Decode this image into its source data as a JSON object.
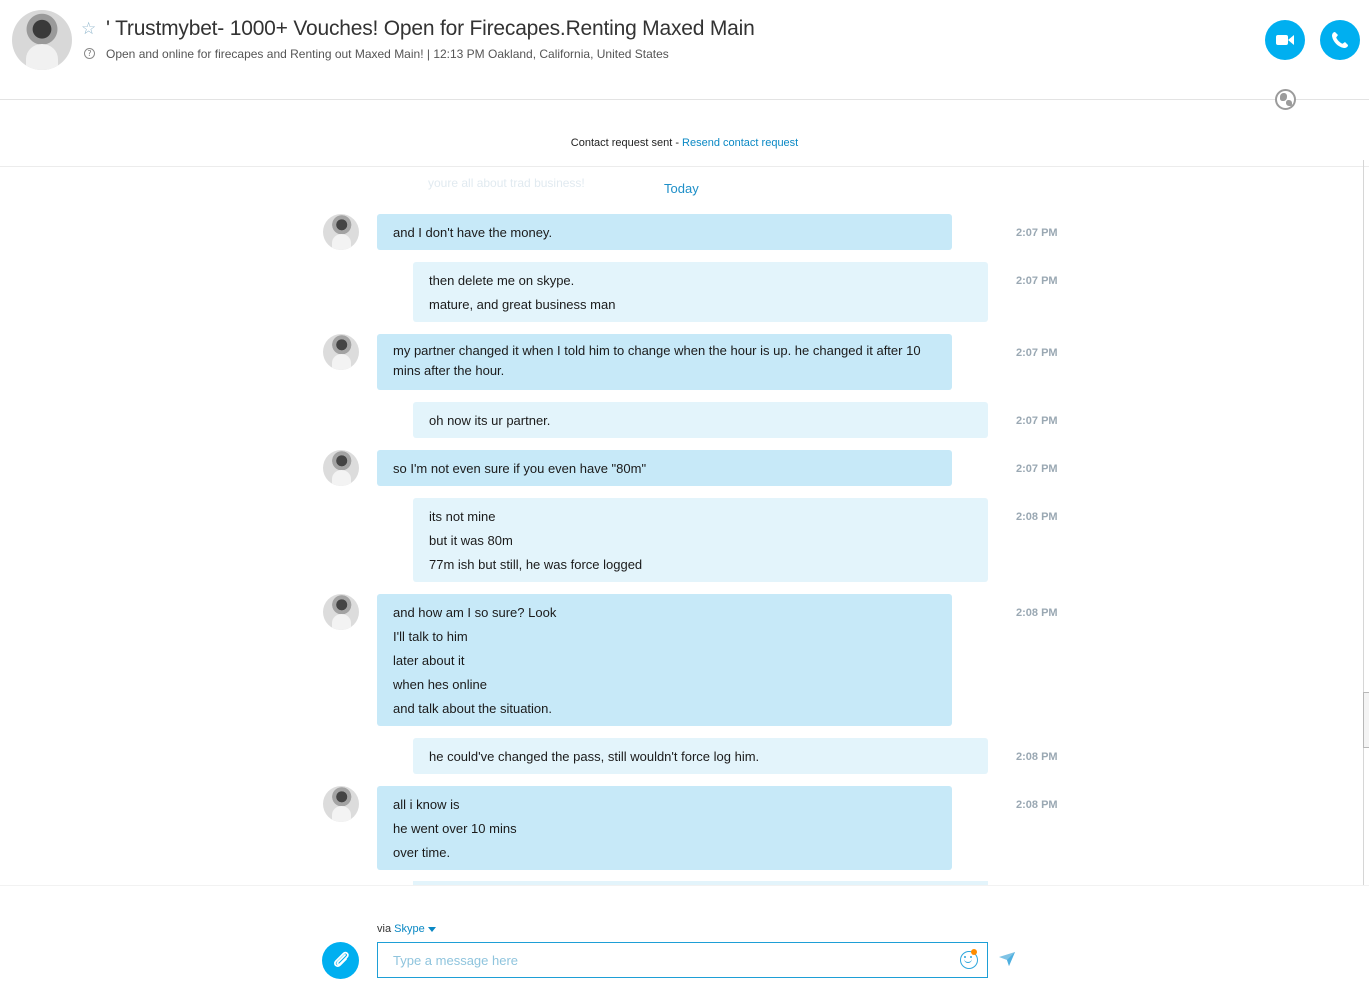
{
  "header": {
    "title": "' Trustmybet- 1000+ Vouches! Open for Firecapes.Renting Maxed Main",
    "subtitle": "Open and online for firecapes and Renting out Maxed Main!  |  12:13 PM Oakland, California, United States",
    "mood_icon_glyph": "?",
    "star_glyph": "☆",
    "icons": [
      "avatar",
      "star-icon",
      "mood-icon",
      "video-call-icon",
      "phone-call-icon",
      "globe-icon"
    ],
    "accent_color": "#00aff0"
  },
  "contact_request": {
    "text": "Contact request sent - ",
    "link": "Resend contact request"
  },
  "conversation": {
    "ghost_text": "youre all about trad business!",
    "date_separator": "Today",
    "messages": [
      {
        "direction": "in",
        "lines": [
          "and I don't have the money."
        ],
        "time": "2:07 PM"
      },
      {
        "direction": "out",
        "lines": [
          "then delete me on skype.",
          "mature, and great business man"
        ],
        "time": "2:07 PM"
      },
      {
        "direction": "in",
        "lines": [
          "my partner changed it when I told him to change when the hour is up. he changed it after 10 mins after the hour."
        ],
        "time": "2:07 PM"
      },
      {
        "direction": "out",
        "lines": [
          "oh now its ur partner."
        ],
        "time": "2:07 PM"
      },
      {
        "direction": "in",
        "lines": [
          "so I'm not even sure if you even have \"80m\""
        ],
        "time": "2:07 PM"
      },
      {
        "direction": "out",
        "lines": [
          "its not mine",
          "but it was 80m",
          "77m ish but still, he was force logged"
        ],
        "time": "2:08 PM"
      },
      {
        "direction": "in",
        "lines": [
          "and how am I so sure? Look",
          "I'll talk to him",
          "later about it",
          "when hes online",
          "and talk about the situation."
        ],
        "time": "2:08 PM"
      },
      {
        "direction": "out",
        "lines": [
          "he could've changed the pass, still wouldn't force log him."
        ],
        "time": "2:08 PM"
      },
      {
        "direction": "in",
        "lines": [
          "all i know is",
          "he went over 10 mins",
          "over time."
        ],
        "time": "2:08 PM"
      }
    ],
    "incoming_bubble_color": "#c7e9f8",
    "outgoing_bubble_color": "#e3f4fb"
  },
  "composer": {
    "via_label": "via ",
    "via_service": "Skype",
    "placeholder": "Type a message here",
    "icons": [
      "attach-icon",
      "emoji-icon",
      "send-icon"
    ]
  }
}
